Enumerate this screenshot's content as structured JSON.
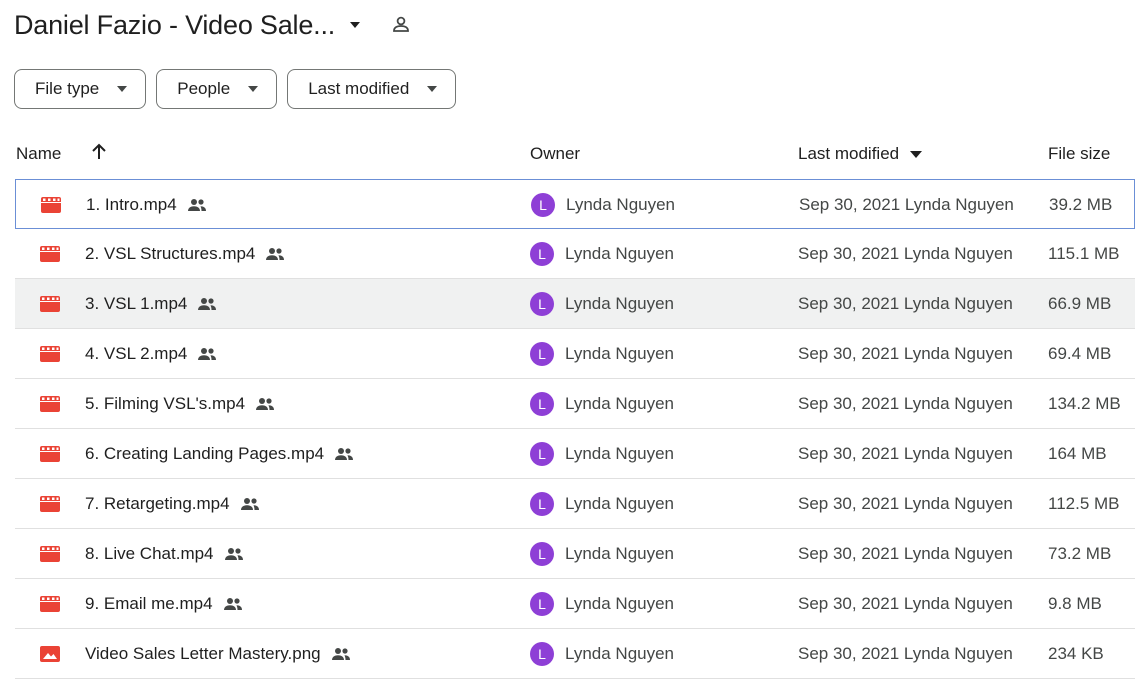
{
  "header": {
    "title": "Daniel Fazio - Video Sale..."
  },
  "filters": [
    {
      "label": "File type"
    },
    {
      "label": "People"
    },
    {
      "label": "Last modified"
    }
  ],
  "columns": {
    "name": "Name",
    "owner": "Owner",
    "modified": "Last modified",
    "size": "File size"
  },
  "files": [
    {
      "name": "1. Intro.mp4",
      "type": "video",
      "owner_initial": "L",
      "owner": "Lynda Nguyen",
      "modified": "Sep 30, 2021 Lynda Nguyen",
      "size": "39.2 MB"
    },
    {
      "name": "2. VSL Structures.mp4",
      "type": "video",
      "owner_initial": "L",
      "owner": "Lynda Nguyen",
      "modified": "Sep 30, 2021 Lynda Nguyen",
      "size": "115.1 MB"
    },
    {
      "name": "3. VSL 1.mp4",
      "type": "video",
      "owner_initial": "L",
      "owner": "Lynda Nguyen",
      "modified": "Sep 30, 2021 Lynda Nguyen",
      "size": "66.9 MB"
    },
    {
      "name": "4. VSL 2.mp4",
      "type": "video",
      "owner_initial": "L",
      "owner": "Lynda Nguyen",
      "modified": "Sep 30, 2021 Lynda Nguyen",
      "size": "69.4 MB"
    },
    {
      "name": "5. Filming VSL's.mp4",
      "type": "video",
      "owner_initial": "L",
      "owner": "Lynda Nguyen",
      "modified": "Sep 30, 2021 Lynda Nguyen",
      "size": "134.2 MB"
    },
    {
      "name": "6. Creating Landing Pages.mp4",
      "type": "video",
      "owner_initial": "L",
      "owner": "Lynda Nguyen",
      "modified": "Sep 30, 2021 Lynda Nguyen",
      "size": "164 MB"
    },
    {
      "name": "7. Retargeting.mp4",
      "type": "video",
      "owner_initial": "L",
      "owner": "Lynda Nguyen",
      "modified": "Sep 30, 2021 Lynda Nguyen",
      "size": "112.5 MB"
    },
    {
      "name": "8. Live Chat.mp4",
      "type": "video",
      "owner_initial": "L",
      "owner": "Lynda Nguyen",
      "modified": "Sep 30, 2021 Lynda Nguyen",
      "size": "73.2 MB"
    },
    {
      "name": "9. Email me.mp4",
      "type": "video",
      "owner_initial": "L",
      "owner": "Lynda Nguyen",
      "modified": "Sep 30, 2021 Lynda Nguyen",
      "size": "9.8 MB"
    },
    {
      "name": "Video Sales Letter Mastery.png",
      "type": "image",
      "owner_initial": "L",
      "owner": "Lynda Nguyen",
      "modified": "Sep 30, 2021 Lynda Nguyen",
      "size": "234 KB"
    }
  ],
  "colors": {
    "file_icon": "#ea4335",
    "avatar": "#8e3fd6",
    "selected_border": "#6b8fd6",
    "hover_row": "#f0f1f1"
  }
}
